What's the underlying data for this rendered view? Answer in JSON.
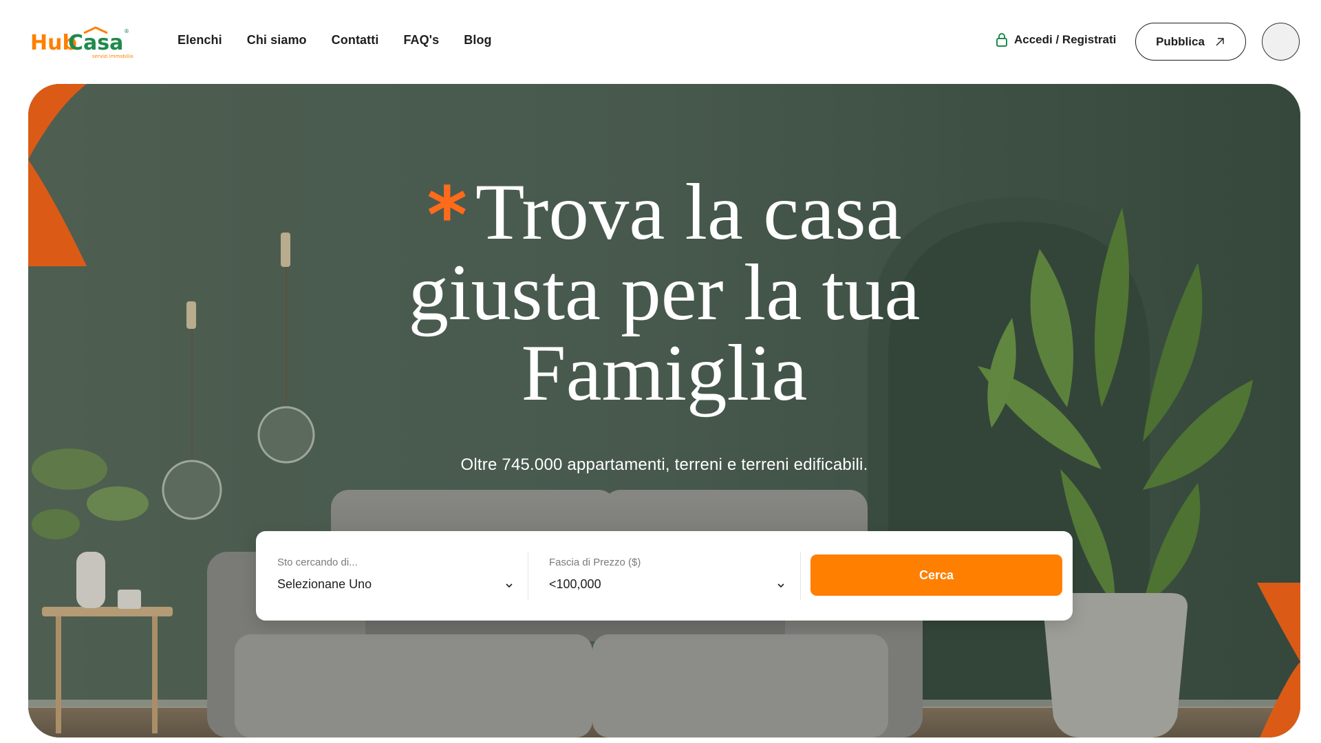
{
  "brand": {
    "name_part1": "Hub",
    "name_part2": "Casa",
    "tagline": "servizi immobiliari",
    "primary": "#ff7f00",
    "secondary": "#1f8a4c"
  },
  "nav": {
    "items": [
      {
        "label": "Elenchi"
      },
      {
        "label": "Chi siamo"
      },
      {
        "label": "Contatti"
      },
      {
        "label": "FAQ's"
      },
      {
        "label": "Blog"
      }
    ]
  },
  "header": {
    "login_label": "Accedi / Registrati",
    "login_icon": "lock-icon",
    "publish_label": "Pubblica",
    "publish_icon": "arrow-up-right-icon"
  },
  "hero": {
    "title_line1": "Trova la casa",
    "title_line2": "giusta per la tua",
    "title_line3": "Famiglia",
    "title_mark": "*",
    "subtitle": "Oltre 745.000 appartamenti, terreni e terreni edificabili.",
    "accent_color": "#ff6b1a"
  },
  "search": {
    "type_label": "Sto cercando di...",
    "type_value": "Selezionane Uno",
    "price_label": "Fascia di Prezzo ($)",
    "price_value": "<100,000",
    "button_label": "Cerca",
    "button_color": "#ff7f00"
  }
}
